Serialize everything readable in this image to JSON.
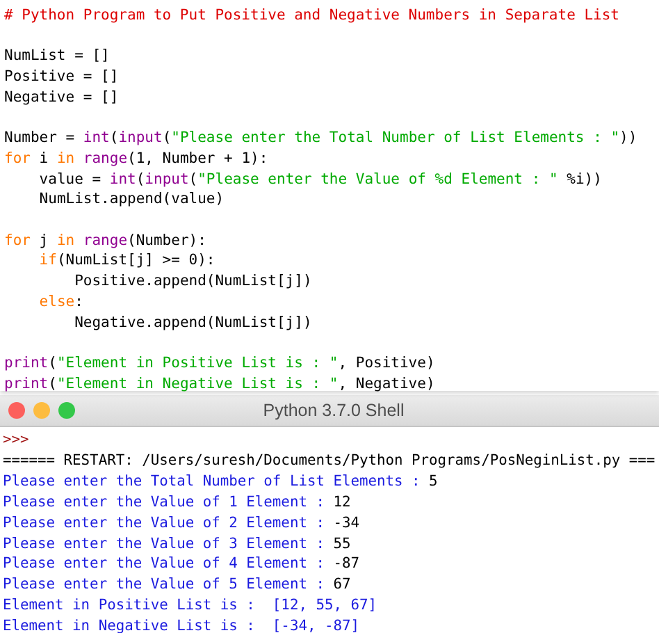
{
  "editor": {
    "lines": [
      {
        "kind": "code",
        "tokens": [
          {
            "kind": "comment",
            "text": "# Python Program to Put Positive and Negative Numbers in Separate List"
          }
        ]
      },
      {
        "kind": "blank"
      },
      {
        "kind": "code",
        "tokens": [
          {
            "kind": "plain",
            "text": "NumList = []"
          }
        ]
      },
      {
        "kind": "code",
        "tokens": [
          {
            "kind": "plain",
            "text": "Positive = []"
          }
        ]
      },
      {
        "kind": "code",
        "tokens": [
          {
            "kind": "plain",
            "text": "Negative = []"
          }
        ]
      },
      {
        "kind": "blank"
      },
      {
        "kind": "code",
        "tokens": [
          {
            "kind": "plain",
            "text": "Number = "
          },
          {
            "kind": "builtin",
            "text": "int"
          },
          {
            "kind": "plain",
            "text": "("
          },
          {
            "kind": "builtin",
            "text": "input"
          },
          {
            "kind": "plain",
            "text": "("
          },
          {
            "kind": "string",
            "text": "\"Please enter the Total Number of List Elements : \""
          },
          {
            "kind": "plain",
            "text": "))"
          }
        ]
      },
      {
        "kind": "code",
        "tokens": [
          {
            "kind": "keyword",
            "text": "for"
          },
          {
            "kind": "plain",
            "text": " i "
          },
          {
            "kind": "keyword",
            "text": "in "
          },
          {
            "kind": "builtin",
            "text": "range"
          },
          {
            "kind": "plain",
            "text": "(1, Number + 1):"
          }
        ],
        "children": [
          {
            "kind": "code",
            "tokens": [
              {
                "kind": "plain",
                "text": "value = "
              },
              {
                "kind": "builtin",
                "text": "int"
              },
              {
                "kind": "plain",
                "text": "("
              },
              {
                "kind": "builtin",
                "text": "input"
              },
              {
                "kind": "plain",
                "text": "("
              },
              {
                "kind": "string",
                "text": "\"Please enter the Value of %d Element : \""
              },
              {
                "kind": "plain",
                "text": " %i))"
              }
            ]
          },
          {
            "kind": "code",
            "tokens": [
              {
                "kind": "plain",
                "text": "NumList.append(value)"
              }
            ]
          }
        ]
      },
      {
        "kind": "blank"
      },
      {
        "kind": "code",
        "tokens": [
          {
            "kind": "keyword",
            "text": "for"
          },
          {
            "kind": "plain",
            "text": " j "
          },
          {
            "kind": "keyword",
            "text": "in "
          },
          {
            "kind": "builtin",
            "text": "range"
          },
          {
            "kind": "plain",
            "text": "(Number):"
          }
        ],
        "children": [
          {
            "kind": "code",
            "tokens": [
              {
                "kind": "keyword",
                "text": "if"
              },
              {
                "kind": "plain",
                "text": "(NumList[j] >= 0):"
              }
            ],
            "children": [
              {
                "kind": "code",
                "tokens": [
                  {
                    "kind": "plain",
                    "text": "Positive.append(NumList[j])"
                  }
                ]
              }
            ]
          },
          {
            "kind": "code",
            "tokens": [
              {
                "kind": "keyword",
                "text": "else"
              },
              {
                "kind": "plain",
                "text": ":"
              }
            ],
            "children": [
              {
                "kind": "code",
                "tokens": [
                  {
                    "kind": "plain",
                    "text": "Negative.append(NumList[j])"
                  }
                ]
              }
            ]
          }
        ]
      },
      {
        "kind": "blank"
      },
      {
        "kind": "code",
        "tokens": [
          {
            "kind": "builtin",
            "text": "print"
          },
          {
            "kind": "plain",
            "text": "("
          },
          {
            "kind": "string",
            "text": "\"Element in Positive List is : \""
          },
          {
            "kind": "plain",
            "text": ", Positive)"
          }
        ]
      },
      {
        "kind": "code",
        "tokens": [
          {
            "kind": "builtin",
            "text": "print"
          },
          {
            "kind": "plain",
            "text": "("
          },
          {
            "kind": "string",
            "text": "\"Element in Negative List is : \""
          },
          {
            "kind": "plain",
            "text": ", Negative)"
          }
        ]
      }
    ]
  },
  "shell": {
    "title": "Python 3.7.0 Shell",
    "lines": [
      {
        "tokens": [
          {
            "kind": "prompt",
            "text": ">>>"
          }
        ]
      },
      {
        "tokens": [
          {
            "kind": "plain",
            "text": "====== RESTART: /Users/suresh/Documents/Python Programs/PosNeginList.py ==="
          }
        ]
      },
      {
        "tokens": [
          {
            "kind": "stdout",
            "text": "Please enter the Total Number of List Elements : "
          },
          {
            "kind": "stdin",
            "text": "5"
          }
        ]
      },
      {
        "tokens": [
          {
            "kind": "stdout",
            "text": "Please enter the Value of 1 Element : "
          },
          {
            "kind": "stdin",
            "text": "12"
          }
        ]
      },
      {
        "tokens": [
          {
            "kind": "stdout",
            "text": "Please enter the Value of 2 Element : "
          },
          {
            "kind": "stdin",
            "text": "-34"
          }
        ]
      },
      {
        "tokens": [
          {
            "kind": "stdout",
            "text": "Please enter the Value of 3 Element : "
          },
          {
            "kind": "stdin",
            "text": "55"
          }
        ]
      },
      {
        "tokens": [
          {
            "kind": "stdout",
            "text": "Please enter the Value of 4 Element : "
          },
          {
            "kind": "stdin",
            "text": "-87"
          }
        ]
      },
      {
        "tokens": [
          {
            "kind": "stdout",
            "text": "Please enter the Value of 5 Element : "
          },
          {
            "kind": "stdin",
            "text": "67"
          }
        ]
      },
      {
        "tokens": [
          {
            "kind": "stdout",
            "text": "Element in Positive List is :  [12, 55, 67]"
          }
        ]
      },
      {
        "tokens": [
          {
            "kind": "stdout",
            "text": "Element in Negative List is :  [-34, -87]"
          }
        ]
      }
    ]
  }
}
